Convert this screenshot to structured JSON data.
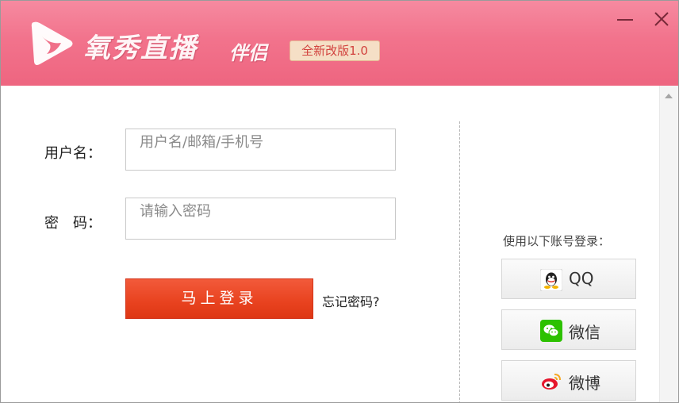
{
  "header": {
    "app_title": "氧秀直播",
    "app_subtitle": "伴侣",
    "version": "全新改版1.0",
    "logo_icon": "play-triangle-logo",
    "colors": {
      "header_bg": "#f2738c",
      "badge_bg": "#f5dfc6",
      "badge_text": "#d2433f"
    }
  },
  "window_controls": {
    "minimize_icon": "minimize-icon",
    "close_icon": "close-icon"
  },
  "form": {
    "username_label": "用户名：",
    "username_placeholder": "用户名/邮箱/手机号",
    "password_label": "密　码：",
    "password_placeholder": "请输入密码",
    "login_button": "马上登录",
    "forgot_link": "忘记密码?"
  },
  "social": {
    "title": "使用以下账号登录：",
    "items": [
      {
        "label": "QQ",
        "icon": "qq-icon"
      },
      {
        "label": "微信",
        "icon": "wechat-icon"
      },
      {
        "label": "微博",
        "icon": "weibo-icon"
      }
    ]
  },
  "colors": {
    "login_button": "#e8421f",
    "wechat_green": "#2dc100",
    "weibo_red": "#e6162d"
  }
}
